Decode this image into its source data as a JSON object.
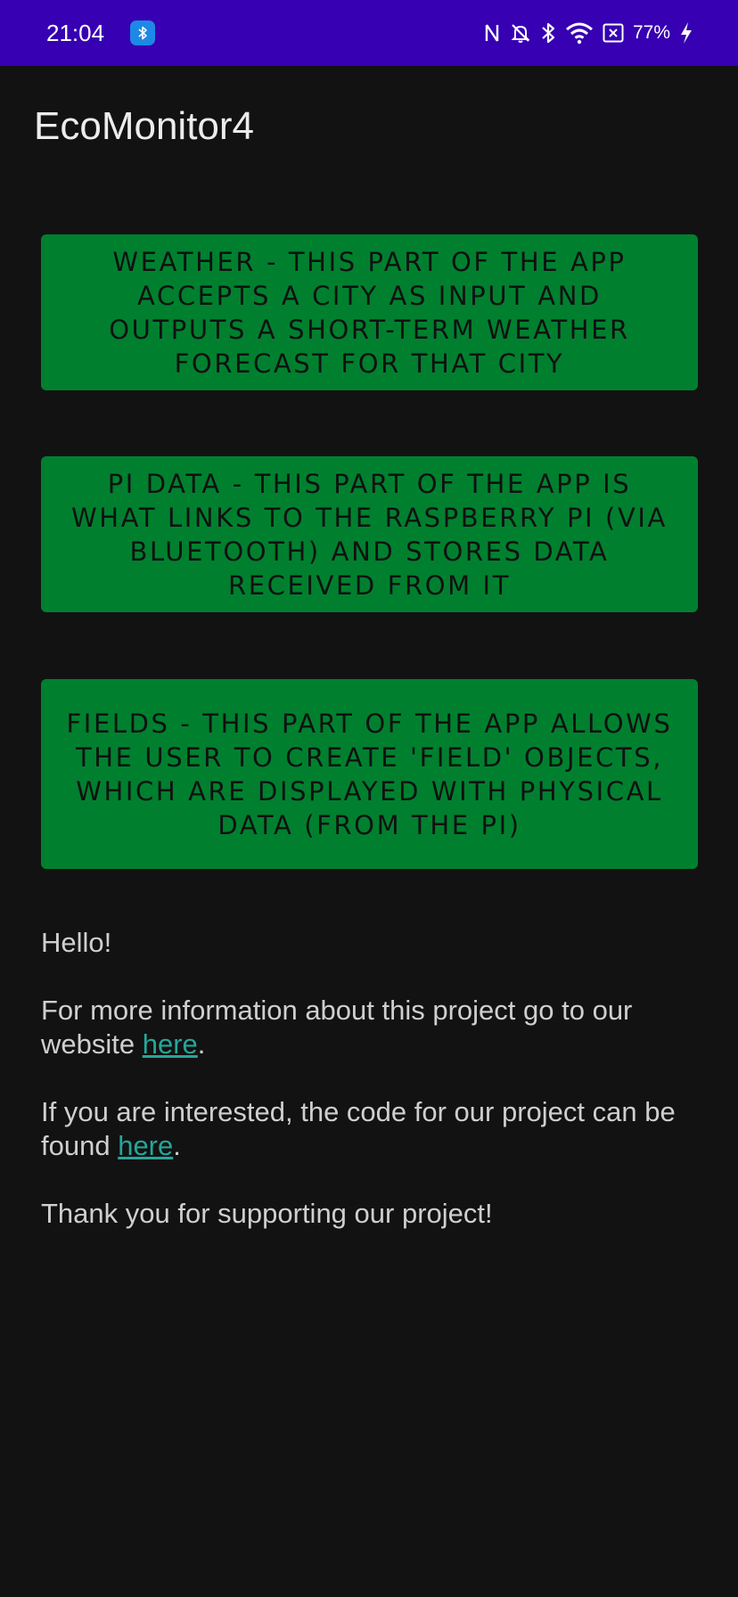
{
  "status_bar": {
    "time": "21:04",
    "battery": "77%",
    "icons": [
      "bluetooth-badge-icon",
      "nfc-icon",
      "bell-muted-icon",
      "bluetooth-icon",
      "wifi-icon",
      "no-sim-icon",
      "battery-charging-icon"
    ],
    "background": "#3700B3"
  },
  "app_bar": {
    "title": "EcoMonitor4"
  },
  "buttons": {
    "weather": "WEATHER - THIS PART OF THE APP ACCEPTS A CITY AS INPUT AND OUTPUTS A SHORT-TERM WEATHER FORECAST FOR THAT CITY",
    "pi_data": "PI DATA - THIS PART OF THE APP IS WHAT LINKS TO THE RASPBERRY PI (VIA BLUETOOTH) AND STORES DATA RECEIVED FROM IT",
    "fields": "FIELDS - THIS PART OF THE APP ALLOWS THE USER TO CREATE 'FIELD' OBJECTS, WHICH ARE DISPLAYED WITH PHYSICAL DATA (FROM THE PI)",
    "color": "#00802F"
  },
  "info": {
    "hello": "Hello!",
    "website_before": "For more information about this project go to our website ",
    "website_link": "here",
    "website_after": ".",
    "code_before": "If you are interested, the code for our project can be found ",
    "code_link": "here",
    "code_after": ".",
    "thanks": "Thank you for supporting our project!",
    "link_color": "#26A69A"
  }
}
